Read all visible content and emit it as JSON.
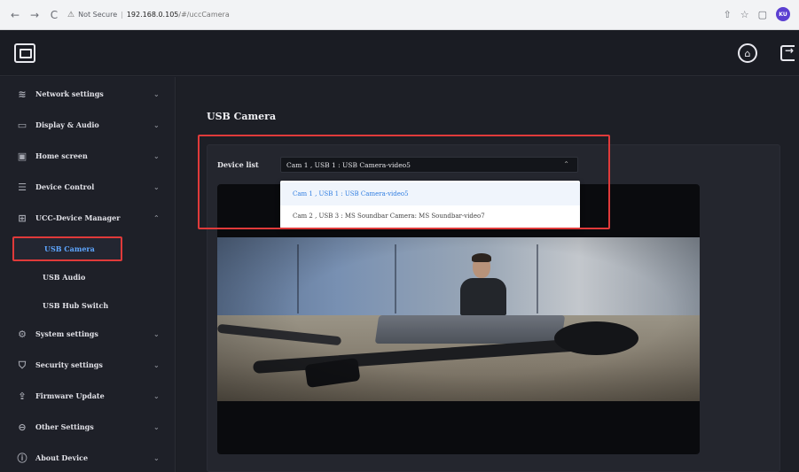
{
  "browser": {
    "nav": [
      "←",
      "→",
      "C"
    ],
    "security_label": "Not Secure",
    "host": "192.168.0.105",
    "path": "/#/uccCamera",
    "profile_initials": "KU"
  },
  "header": {
    "home_icon": "home-icon",
    "logout_icon": "logout-icon"
  },
  "sidebar": {
    "items": [
      {
        "label": "Network settings",
        "icon": "wifi-icon",
        "glyph": "≋",
        "chevron": "⌄"
      },
      {
        "label": "Display & Audio",
        "icon": "monitor-icon",
        "glyph": "▭",
        "chevron": "⌄"
      },
      {
        "label": "Home screen",
        "icon": "home-screen-icon",
        "glyph": "▣",
        "chevron": "⌄"
      },
      {
        "label": "Device Control",
        "icon": "sliders-icon",
        "glyph": "☰",
        "chevron": "⌄"
      },
      {
        "label": "UCC-Device Manager",
        "icon": "device-manager-icon",
        "glyph": "⊞",
        "chevron": "⌃"
      }
    ],
    "subitems": [
      {
        "label": "USB Camera",
        "active": true
      },
      {
        "label": "USB Audio",
        "active": false
      },
      {
        "label": "USB Hub Switch",
        "active": false
      }
    ],
    "items2": [
      {
        "label": "System settings",
        "icon": "gear-icon",
        "glyph": "⚙",
        "chevron": "⌄"
      },
      {
        "label": "Security settings",
        "icon": "shield-icon",
        "glyph": "⛉",
        "chevron": "⌄"
      },
      {
        "label": "Firmware Update",
        "icon": "upload-icon",
        "glyph": "⇪",
        "chevron": "⌄"
      },
      {
        "label": "Other Settings",
        "icon": "more-icon",
        "glyph": "⊖",
        "chevron": "⌄"
      },
      {
        "label": "About Device",
        "icon": "info-icon",
        "glyph": "ⓘ",
        "chevron": "⌄"
      }
    ]
  },
  "main": {
    "title": "USB Camera",
    "device_list_label": "Device list",
    "selected_device": "Cam 1 , USB 1 : USB Camera-video5",
    "options": [
      "Cam 1 , USB 1 : USB Camera-video5",
      "Cam 2 , USB 3 : MS Soundbar Camera: MS Soundbar-video7"
    ]
  },
  "colors": {
    "accent": "#5ea6ff",
    "highlight_border": "#e03a3a",
    "selected_option": "#2f7de1"
  }
}
